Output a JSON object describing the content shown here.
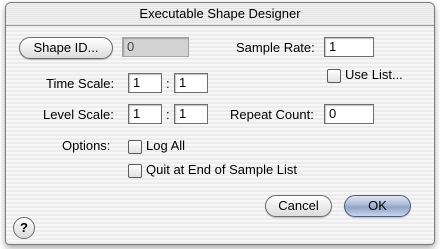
{
  "window": {
    "title": "Executable Shape Designer"
  },
  "shape": {
    "button_label": "Shape ID...",
    "id_value": "0"
  },
  "sample_rate": {
    "label": "Sample Rate:",
    "value": "1"
  },
  "use_list": {
    "label": "Use List...",
    "checked": false
  },
  "time_scale": {
    "label": "Time Scale:",
    "numerator": "1",
    "separator": ":",
    "denominator": "1"
  },
  "level_scale": {
    "label": "Level Scale:",
    "numerator": "1",
    "separator": ":",
    "denominator": "1"
  },
  "repeat_count": {
    "label": "Repeat Count:",
    "value": "0"
  },
  "options": {
    "label": "Options:",
    "log_all": {
      "label": "Log All",
      "checked": false
    },
    "quit_at_end": {
      "label": "Quit at End of Sample List",
      "checked": false
    }
  },
  "buttons": {
    "cancel": "Cancel",
    "ok": "OK",
    "help": "?"
  }
}
